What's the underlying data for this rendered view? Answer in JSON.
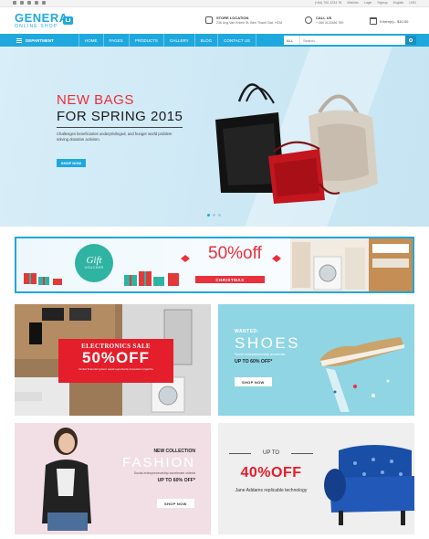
{
  "topbar": {
    "social": [
      "f-icon",
      "twitter-icon",
      "google-icon",
      "instagram-icon",
      "youtube-icon"
    ],
    "phone": "(+84) 700 1234 78",
    "links": [
      "Wishlist",
      "Login",
      "Signup",
      "English",
      "USD"
    ]
  },
  "header": {
    "logo_main": "GENERA",
    "logo_sub": "ONLINE SHOP",
    "store_title": "STORE LOCATION",
    "store_text": "236 Ung Van Khiem St, Binh Thanh Dist, HCM",
    "call_title": "CALL US",
    "call_text": "+ 084 0123456 789",
    "cart_text": "0 item(s) - $10.00"
  },
  "nav": {
    "department": "DEPARTMENT",
    "menu": [
      "HOME",
      "PAGES",
      "PRODUCTS",
      "GALLERY",
      "BLOG",
      "CONTACT US"
    ],
    "search_category": "ALL",
    "search_placeholder": "Search..."
  },
  "hero": {
    "title1": "NEW BAGS",
    "title2": "FOR SPRING 2015",
    "description": "Challenges beneficiaries underprivileged, and hunger world problem solving donation activism.",
    "button": "SHOP NOW"
  },
  "promo": {
    "gift_title": "Gift",
    "gift_sub": "VOUCHER",
    "percent": "50%off",
    "sub": "CHRISTMAS"
  },
  "tiles": {
    "electronics": {
      "title": "ELECTRONICS SALE",
      "percent": "50%OFF",
      "desc": "Global financial system equal opportunity innovation organize"
    },
    "shoes": {
      "label": "WANTED:",
      "title": "SHOES",
      "sub": "Social entrepreneurship accelerate",
      "off": "UP TO 60% OFF*",
      "button": "SHOP NOW"
    },
    "fashion": {
      "label": "NEW COLLECTION",
      "title": "FASHION",
      "sub": "Social entrepreneurship accelerate criteria",
      "off": "UP TO 60% OFF*",
      "button": "SHOP NOW"
    },
    "sofa": {
      "up": "UP TO",
      "percent": "40%OFF",
      "sub": "Jane Addams replicable technology"
    }
  },
  "colors": {
    "accent": "#1fa8de",
    "red": "#e8313c"
  }
}
